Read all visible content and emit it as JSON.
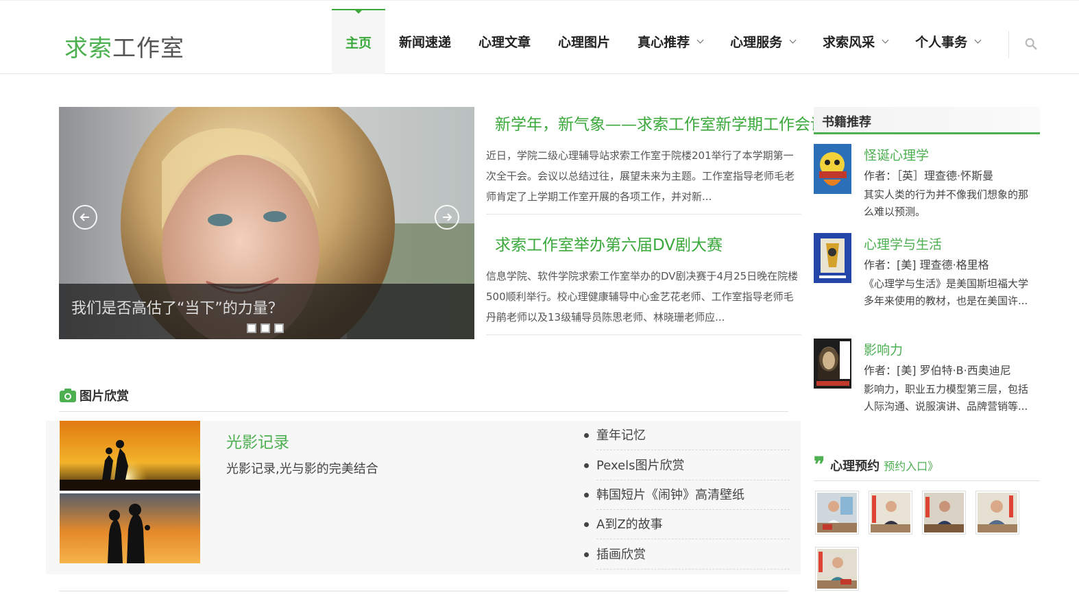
{
  "logo": {
    "part1": "求索",
    "part2": "工作室"
  },
  "nav": {
    "items": [
      {
        "label": "主页",
        "active": true,
        "dropdown": false
      },
      {
        "label": "新闻速递",
        "active": false,
        "dropdown": false
      },
      {
        "label": "心理文章",
        "active": false,
        "dropdown": false
      },
      {
        "label": "心理图片",
        "active": false,
        "dropdown": false
      },
      {
        "label": "真心推荐",
        "active": false,
        "dropdown": true
      },
      {
        "label": "心理服务",
        "active": false,
        "dropdown": true
      },
      {
        "label": "求索风采",
        "active": false,
        "dropdown": true
      },
      {
        "label": "个人事务",
        "active": false,
        "dropdown": true
      }
    ],
    "search_icon": "search-icon"
  },
  "slider": {
    "caption": "我们是否高估了“当下”的力量？",
    "slide_count": 3
  },
  "news": [
    {
      "title": "新学年，新气象——求索工作室新学期工作会议",
      "summary": "近日，学院二级心理辅导站求索工作室于院楼201举行了本学期第一次全干会。会议以总结过往，展望未来为主题。工作室指导老师毛老师肯定了上学期工作室开展的各项工作，并对新..."
    },
    {
      "title": "求索工作室举办第六届DV剧大赛",
      "summary": "信息学院、软件学院求索工作室举办的DV剧决赛于4月25日晚在院楼500顺利举行。校心理健康辅导中心金艺花老师、工作室指导老师毛丹鹃老师以及13级辅导员陈思老师、林晓珊老师应..."
    }
  ],
  "photos": {
    "section_title": "图片欣赏",
    "album": {
      "title": "光影记录",
      "desc": "光影记录,光与影的完美结合"
    },
    "list": [
      "童年记忆",
      "Pexels图片欣赏",
      "韩国短片《闹钟》高清壁纸",
      "A到Z的故事",
      "插画欣赏"
    ]
  },
  "sidebar": {
    "books_title": "书籍推荐",
    "books": [
      {
        "title": "怪诞心理学",
        "author": "作者：［英］理查德·怀斯曼",
        "desc": "其实人类的行为并不像我们想象的那么难以预测。"
      },
      {
        "title": "心理学与生活",
        "author": "作者：[美] 理查德·格里格",
        "desc": "《心理学与生活》是美国斯坦福大学多年来使用的教材，也是在美国许..."
      },
      {
        "title": "影响力",
        "author": "作者：[美] 罗伯特·B·西奥迪尼",
        "desc": "影响力，职业五力模型第三层，包括人际沟通、说服演讲、品牌营销等..."
      }
    ],
    "appointment": {
      "title": "心理预约",
      "link": "预约入口》"
    }
  },
  "colors": {
    "accent": "#4caf50",
    "nav_active": "#3aa83a"
  }
}
